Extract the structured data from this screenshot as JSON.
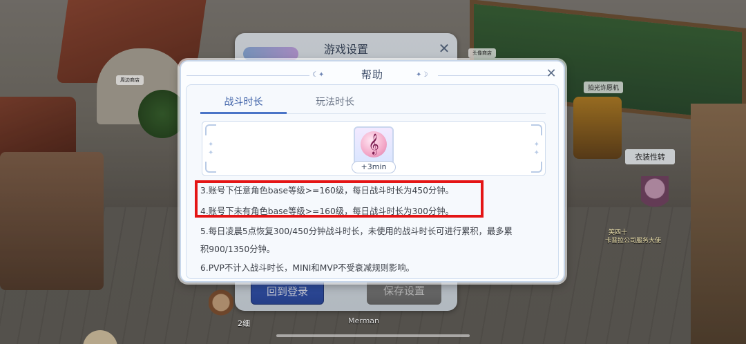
{
  "scene": {
    "labels": {
      "shop": "周边商店",
      "flash": "拍光许愿机",
      "costume": "衣装性转",
      "avatar": "头像商店",
      "merman": "Merman",
      "player_level": "2细",
      "npc_name": "笑四十",
      "npc_guild": "卡普拉公司服务大使"
    }
  },
  "settings_dialog": {
    "title": "游戏设置",
    "back_to_login_label": "回到登录",
    "save_label": "保存设置"
  },
  "help_dialog": {
    "title": "帮助",
    "tabs": [
      {
        "label": "战斗时长",
        "active": true
      },
      {
        "label": "玩法时长",
        "active": false
      }
    ],
    "reward": {
      "icon": "music-note-icon",
      "label": "+3min"
    },
    "rules": [
      "3.账号下任意角色base等级>=160级，每日战斗时长为450分钟。",
      "4.账号下未有角色base等级>=160级，每日战斗时长为300分钟。",
      "5.每日凌晨5点恢复300/450分钟战斗时长，未使用的战斗时长可进行累积，最多累",
      "积900/1350分钟。",
      "6.PVP不计入战斗时长，MINI和MVP不受衰减规则影响。"
    ],
    "highlight_color": "#e41515"
  },
  "colors": {
    "accent": "#4a74c7",
    "primary_button": "#3d64c8"
  }
}
